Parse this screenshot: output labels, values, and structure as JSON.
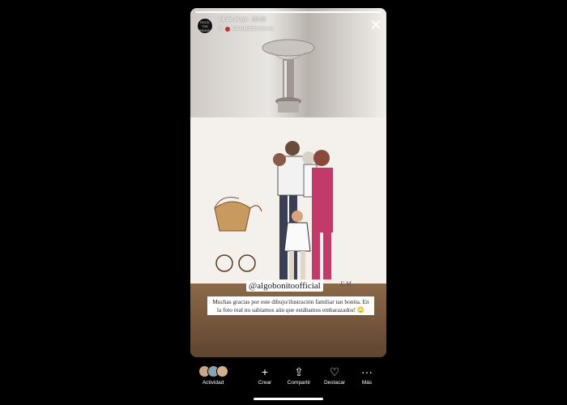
{
  "story": {
    "progress": 1.0,
    "account_badge_text": "ROCK THE BRAND",
    "date": "14 de mayo",
    "time": "20:28",
    "repost_username": "lorotogordomoreno",
    "close_icon": "close-icon"
  },
  "content": {
    "mention_tag": "@algobonitoofficial",
    "caption": "Muchas gracias por este dibujo/ilustración familiar tan bonita. En la foto real no sabíamos aún que estábamos embarazados! 🙄",
    "signature": "E.M."
  },
  "bottom_bar": {
    "items": [
      {
        "label": "Actividad",
        "icon": "viewers-avatars-icon"
      },
      {
        "label": "Crear",
        "icon": "plus-icon"
      },
      {
        "label": "Compartir",
        "icon": "share-icon"
      },
      {
        "label": "Destacar",
        "icon": "highlight-heart-icon"
      },
      {
        "label": "Más",
        "icon": "more-icon"
      }
    ]
  },
  "colors": {
    "background": "#000000",
    "text": "#ffffff"
  }
}
